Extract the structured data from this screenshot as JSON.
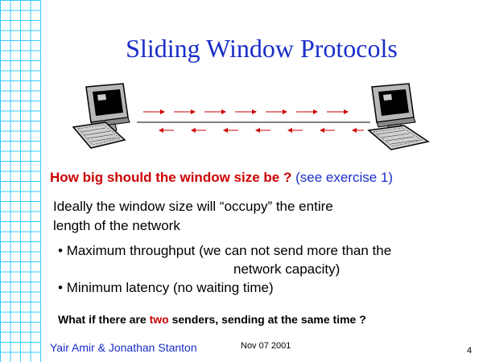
{
  "slide": {
    "title": "Sliding Window Protocols",
    "question": "How big should the window size be ?",
    "question_ref": "(see exercise 1)",
    "ideal_line1": "Ideally the window size will “occupy” the entire",
    "ideal_line2": "length of the network",
    "bullet1_line1": "Maximum throughput (we can not send more than the",
    "bullet1_line2": "network capacity)",
    "bullet2": "Minimum latency (no waiting time)",
    "whatif_prefix": "What if there are",
    "whatif_highlight": "two",
    "whatif_suffix": "senders, sending at the same time ?",
    "bullet_char": "•"
  },
  "footer": {
    "authors": "Yair Amir & Jonathan Stanton",
    "date": "Nov 07 2001",
    "page": "4"
  },
  "colors": {
    "title": "#1a2ec8",
    "question": "#cc0000",
    "arrows": "#cc0000",
    "grid": "#33ccff"
  },
  "icons": [
    "computer-icon-left",
    "computer-icon-right",
    "arrow-right-icon",
    "arrow-left-icon"
  ]
}
